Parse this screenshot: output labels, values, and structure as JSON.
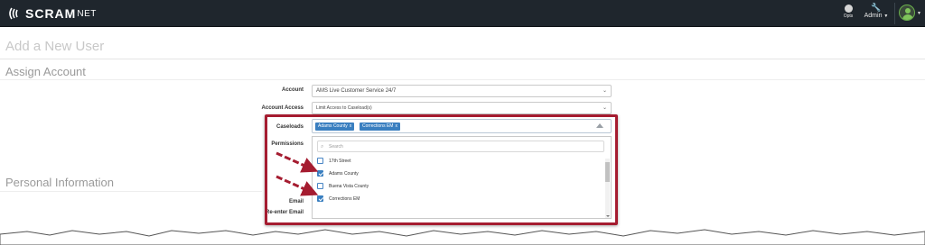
{
  "app": {
    "brand_main": "SCRAM",
    "brand_suffix": "NET"
  },
  "navbar": {
    "opts_label": "Opts",
    "admin_label": "Admin",
    "icons": [
      "gauge-icon",
      "wrench-icon",
      "user-avatar-icon"
    ]
  },
  "page": {
    "title": "Add a New User",
    "section_assign": "Assign Account",
    "section_personal": "Personal Information"
  },
  "form": {
    "account_label": "Account",
    "account_value": "AMS Live Customer Service 24/7",
    "account_access_label": "Account Access",
    "account_access_value": "Limit Access to Caseload(s)",
    "caseloads_label": "Caseloads",
    "permissions_label": "Permissions",
    "email_label": "Email",
    "reenter_email_label": "Re-enter Email",
    "selected_caseloads": [
      {
        "label": "Adams County",
        "remove": "x"
      },
      {
        "label": "Corrections EM",
        "remove": "x"
      }
    ],
    "dropdown": {
      "search_placeholder": "Search",
      "options": [
        {
          "label": "17th Street",
          "checked": false
        },
        {
          "label": "Adams County",
          "checked": true
        },
        {
          "label": "Buena Vista County",
          "checked": false
        },
        {
          "label": "Corrections EM",
          "checked": true
        }
      ]
    }
  },
  "colors": {
    "navbar_bg": "#1f262d",
    "tag_bg": "#3a7fc0",
    "annotation_red": "#a51c30"
  }
}
